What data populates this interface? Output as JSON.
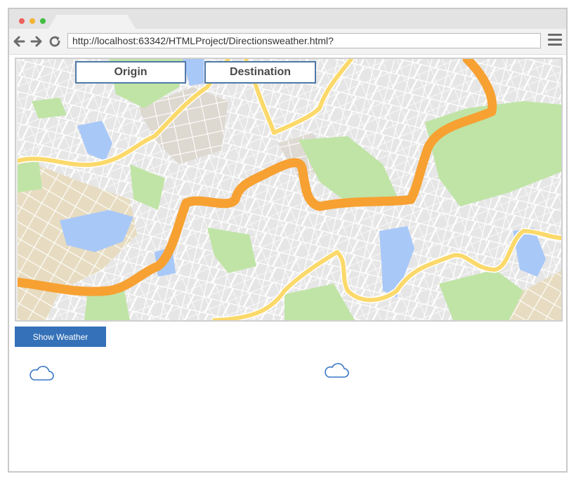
{
  "browser": {
    "url": "http://localhost:63342/HTMLProject/Directionsweather.html?"
  },
  "map": {
    "origin_placeholder": "Origin",
    "destination_placeholder": "Destination"
  },
  "actions": {
    "show_weather_label": "Show Weather"
  },
  "weather": {
    "origin_icon": "cloud-icon",
    "destination_icon": "cloud-icon"
  },
  "colors": {
    "button_blue": "#3571b8",
    "route_orange": "#f7a132",
    "road_yellow": "#fbd96a",
    "water_blue": "#a8c8f8",
    "park_green": "#c0e4a6",
    "cloud_outline": "#3a78c7"
  }
}
